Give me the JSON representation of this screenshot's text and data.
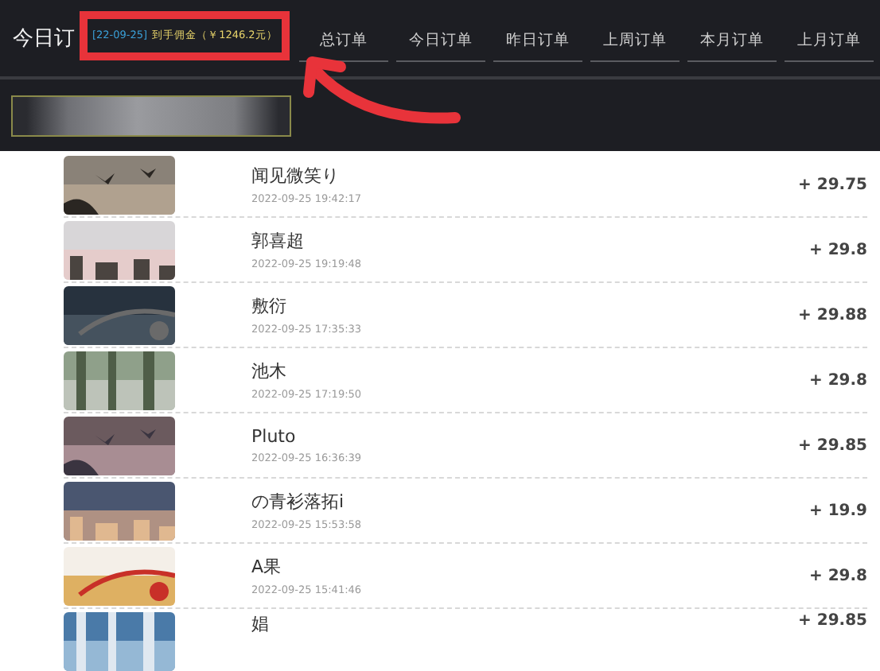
{
  "header": {
    "title": "今日订",
    "date_badge": "[22-09-25]",
    "commission": "到手佣金（￥1246.2元）",
    "tabs": [
      {
        "label": "总订单",
        "selected": false
      },
      {
        "label": "今日订单",
        "selected": false
      },
      {
        "label": "昨日订单",
        "selected": false
      },
      {
        "label": "上周订单",
        "selected": false
      },
      {
        "label": "本月订单",
        "selected": false
      },
      {
        "label": "上月订单",
        "selected": false
      }
    ]
  },
  "orders": [
    {
      "name": "闻见微笑り",
      "time": "2022-09-25 19:42:17",
      "amount": "+ 29.75"
    },
    {
      "name": "郭喜超",
      "time": "2022-09-25 19:19:48",
      "amount": "+ 29.8"
    },
    {
      "name": "敷衍",
      "time": "2022-09-25 17:35:33",
      "amount": "+ 29.88"
    },
    {
      "name": "池木",
      "time": "2022-09-25 17:19:50",
      "amount": "+ 29.8"
    },
    {
      "name": "Pluto",
      "time": "2022-09-25 16:36:39",
      "amount": "+ 29.85"
    },
    {
      "name": "の青衫落拓i",
      "time": "2022-09-25 15:53:58",
      "amount": "+ 19.9"
    },
    {
      "name": "A果",
      "time": "2022-09-25 15:41:46",
      "amount": "+ 29.8"
    },
    {
      "name": "娼",
      "amount": "+ 29.85"
    }
  ]
}
